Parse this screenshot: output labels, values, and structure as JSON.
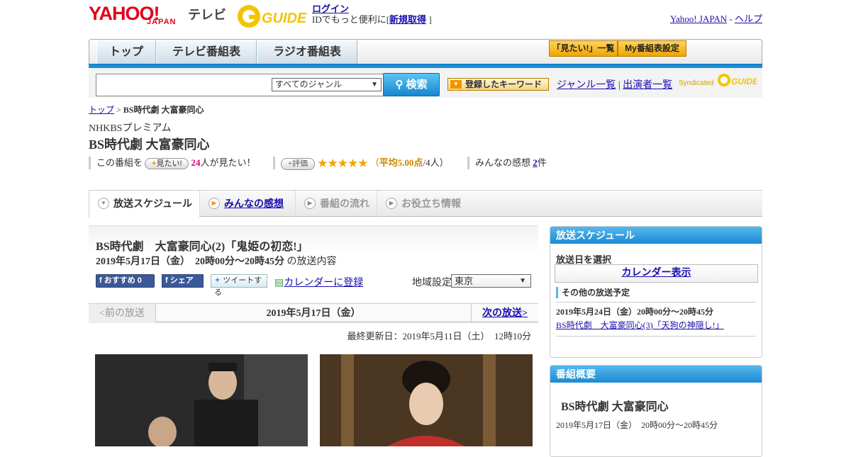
{
  "header": {
    "logo_yahoo": "YAHOO!",
    "logo_japan": "JAPAN",
    "logo_tv": "テレビ",
    "gguide": "G GUIDE",
    "login_label": "ログイン",
    "login_text": "IDでもっと便利に[",
    "signup_label": "新規取得",
    "signup_close": " ]",
    "yahoo_japan_link": "Yahoo! JAPAN",
    "separator": "-",
    "help_link": "ヘルプ"
  },
  "nav": {
    "tabs": [
      "トップ",
      "テレビ番組表",
      "ラジオ番組表"
    ],
    "mitai_list": "「見たい!」一覧",
    "my_schedule": "My番組表設定"
  },
  "search": {
    "genre_selected": "すべてのジャンル",
    "search_button": "検索",
    "keyword_button": "登録したキーワード",
    "genre_list": "ジャンル一覧",
    "pipe": "|",
    "performer_list": "出演者一覧",
    "syndicated": "Syndicated"
  },
  "breadcrumb": {
    "top": "トップ",
    "sep": " > ",
    "current": "BS時代劇 大富豪同心"
  },
  "program": {
    "channel": "NHKBSプレミアム",
    "title": "BS時代劇 大富豪同心",
    "mitai_prefix": "この番組を",
    "mitai_button": "見たい!",
    "mitai_count": "24",
    "mitai_suffix": "人が見たい！",
    "hyoka_button": "評価",
    "stars": "★★★★★",
    "rating_open": "（",
    "rating_avg": "平均5.00点",
    "rating_people": "/4人）",
    "comments_label": "みんなの感想",
    "comments_count": "2",
    "comments_unit": "件"
  },
  "subtabs": [
    "放送スケジュール",
    "みんなの感想",
    "番組の流れ",
    "お役立ち情報"
  ],
  "episode": {
    "title": "BS時代劇　大富豪同心(2)「鬼姫の初恋!」",
    "date": "2019年5月17日（金）　20時00分～20時45分",
    "date_suffix": "の放送内容",
    "social": {
      "recommend": "おすすめ 0",
      "share": "シェア",
      "tweet": "ツイートする"
    },
    "calendar_register": "カレンダーに登録",
    "region_label": "地域設定",
    "region_selected": "東京"
  },
  "pager": {
    "prev": "<前の放送",
    "current": "2019年5月17日（金）",
    "next": "次の放送>"
  },
  "updated": "最終更新日：2019年5月11日（土）　12時10分",
  "sidebar": {
    "schedule_header": "放送スケジュール",
    "select_date": "放送日を選択",
    "calendar_button": "カレンダー表示",
    "other_schedule": "その他の放送予定",
    "next_date": "2019年5月24日（金）20時00分～20時45分",
    "next_title": "BS時代劇　大富豪同心(3)「天狗の神隠し!」",
    "summary_header": "番組概要",
    "summary_title": "BS時代劇 大富豪同心",
    "summary_date": "2019年5月17日（金）　20時00分～20時45分"
  }
}
